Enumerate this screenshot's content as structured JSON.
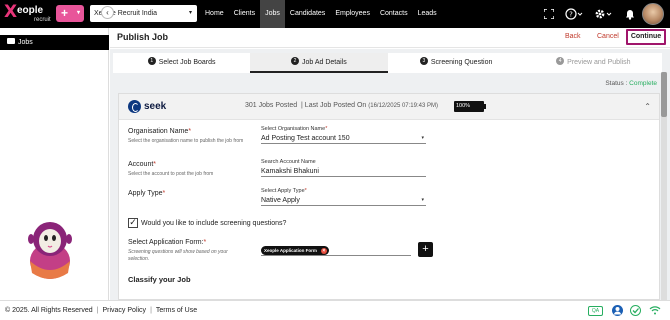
{
  "topbar": {
    "logo_x": "X",
    "logo_word": "eople",
    "logo_sub": "recruit",
    "plus_label": "+",
    "plus_caret": "▾",
    "org_selected": "Xeople Recruit India",
    "nav": [
      "Home",
      "Clients",
      "Jobs",
      "Candidates",
      "Employees",
      "Contacts",
      "Leads"
    ],
    "active_nav": "Jobs",
    "icons": [
      "fullscreen-icon",
      "help-icon",
      "settings-icon",
      "bell-icon",
      "avatar"
    ]
  },
  "sidebar": {
    "jobs_label": "Jobs",
    "collapse_glyph": "‹"
  },
  "header": {
    "title": "Publish Job",
    "back_label": "Back",
    "cancel_label": "Cancel",
    "continue_label": "Continue"
  },
  "steps": [
    {
      "num": "1",
      "label": "Select Job Boards",
      "state": "done"
    },
    {
      "num": "2",
      "label": "Job Ad Details",
      "state": "active"
    },
    {
      "num": "3",
      "label": "Screening Question",
      "state": "pending"
    },
    {
      "num": "4",
      "label": "Preview and Publish",
      "state": "disabled"
    }
  ],
  "status": {
    "label": "Status : ",
    "value": "Complete"
  },
  "board": {
    "name": "seek",
    "jobs_posted": "301 Jobs Posted",
    "last_posted_label": "| Last Job Posted On",
    "last_posted_date": "(16/12/2025 07:19:43 PM)",
    "quota": "100%",
    "chevron": "⌃"
  },
  "form": {
    "org_label": "Organisation Name",
    "org_help": "Select the organisation name to publish the job from",
    "org_ctl_label": "Select Organisation Name",
    "org_value": "Ad Posting Test account 150",
    "account_label": "Account",
    "account_help": "Select the account to post the job from",
    "account_ctl_label": "Search Account Name",
    "account_value": "Kamakshi Bhakuni",
    "apply_label": "Apply Type",
    "apply_ctl_label": "Select Apply Type",
    "apply_value": "Native Apply",
    "screening_checked": "✓",
    "screening_label": "Would you like to include screening questions?",
    "app_form_label": "Select Application Form:",
    "app_form_help": "Screening questions will show based on your",
    "app_form_help2": "selection.",
    "app_form_chip": "Xeople Application Form",
    "chip_close": "×",
    "add_glyph": "+",
    "classify_title": "Classify your Job",
    "required_mark": "*",
    "caret": "▾"
  },
  "footer": {
    "copyright": "© 2025. All Rights Reserved",
    "privacy": "Privacy Policy",
    "terms": "Terms of Use",
    "sep": "|",
    "qa_badge": "QA"
  },
  "colors": {
    "brand_pink": "#e8559a",
    "continue_border": "#a0156b",
    "status_green": "#27ae60",
    "seek_navy": "#0d3880"
  }
}
